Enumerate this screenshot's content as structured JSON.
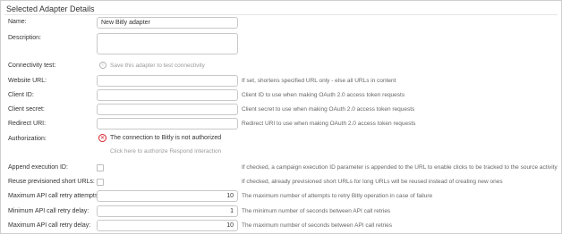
{
  "section": {
    "title": "Selected Adapter Details"
  },
  "fields": {
    "name": {
      "label": "Name:",
      "value": "New Bitly adapter"
    },
    "description": {
      "label": "Description:",
      "value": ""
    },
    "connectivity": {
      "label": "Connectivity test:",
      "info_icon": "info-icon",
      "message": "Save this adapter to test connectivity"
    },
    "website_url": {
      "label": "Website URL:",
      "value": "",
      "hint": "If set, shortens specified URL only - else all URLs in content"
    },
    "client_id": {
      "label": "Client ID:",
      "value": "",
      "hint": "Client ID to use when making OAuth 2.0 access token requests"
    },
    "client_secret": {
      "label": "Client secret:",
      "value": "",
      "hint": "Client secret to use when making OAuth 2.0 access token requests"
    },
    "redirect_uri": {
      "label": "Redirect URI:",
      "value": "",
      "hint": "Redirect URI to use when making OAuth 2.0 access token requests"
    },
    "authorization": {
      "label": "Authorization:",
      "status_icon": "error-x-icon",
      "status": "The connection to Bitly is not authorized",
      "link": "Click here to authorize Respond interaction",
      "error_color": "#d9202c"
    },
    "append_execution_id": {
      "label": "Append execution ID:",
      "checked": false,
      "hint": "If checked, a campaign execution ID parameter is appended to the URL to enable clicks to be tracked to the source activity"
    },
    "reuse_short_urls": {
      "label": "Reuse previsioned short URLs:",
      "checked": false,
      "hint": "If checked, already previsioned short URLs for long URLs will be reused instead of creating new ones"
    },
    "max_retry_attempts": {
      "label": "Maximum API call retry attempts:",
      "value": "10",
      "hint": "The maximum number of attempts to retry Bitly operation in case of failure"
    },
    "min_retry_delay": {
      "label": "Minimum API call retry delay:",
      "value": "1",
      "hint": "The minimum number of seconds between API call retries"
    },
    "max_retry_delay": {
      "label": "Maximum API call retry delay:",
      "value": "10",
      "hint": "The maximum number of seconds between API call retries"
    }
  }
}
